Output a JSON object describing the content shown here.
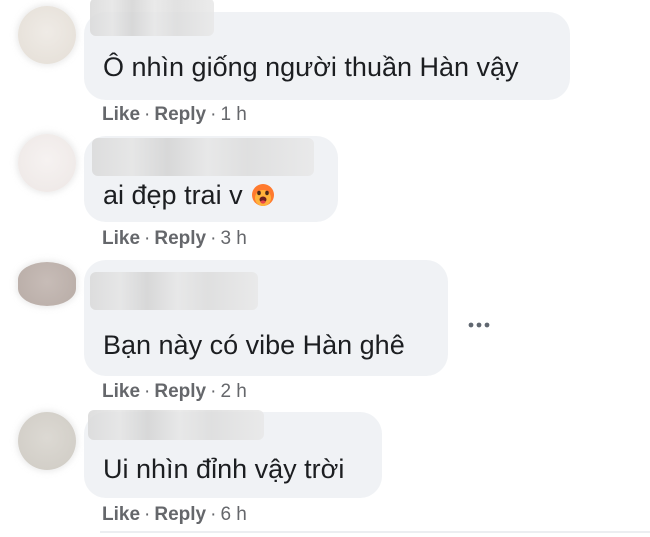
{
  "comments": [
    {
      "text": "Ô nhìn giống người thuần Hàn vậy",
      "like": "Like",
      "reply": "Reply",
      "time": "1 h"
    },
    {
      "text": "ai đẹp trai v",
      "like": "Like",
      "reply": "Reply",
      "time": "3 h",
      "emoji": "hot-face-emoji"
    },
    {
      "text": "Bạn này có vibe Hàn ghê",
      "like": "Like",
      "reply": "Reply",
      "time": "2 h"
    },
    {
      "text": "Ui nhìn đỉnh vậy trời",
      "like": "Like",
      "reply": "Reply",
      "time": "6 h"
    }
  ],
  "separator": "·",
  "icons": {
    "more": "more-options-icon"
  },
  "colors": {
    "bubble": "#f0f2f5",
    "meta": "#65676b",
    "text": "#1c1e21"
  }
}
